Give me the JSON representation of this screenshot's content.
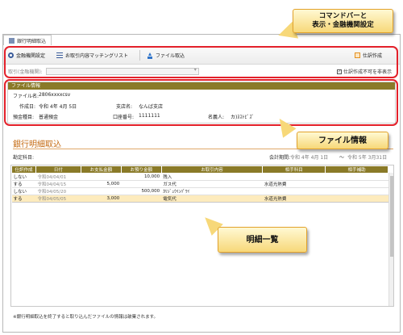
{
  "tab": {
    "label": "銀行明細取込"
  },
  "toolbar": {
    "bank_settings": "金融機関設定",
    "matching_list": "お取引内容マッチングリスト",
    "file_import": "ファイル取込",
    "journal": "仕訳作成"
  },
  "filter": {
    "label": "取引(金融機関):",
    "checkbox_label": "仕訳作成不可を非表示"
  },
  "file_info": {
    "header": "ファイル情報",
    "filename_label": "ファイル名:",
    "filename": "2806xxxxcsv",
    "created_label": "作成日:",
    "created": "令和 4年 4月 5日",
    "branch_label": "支店名:",
    "branch": "なんば支店",
    "account_type_label": "預金種目:",
    "account_type": "普通預金",
    "account_no_label": "口座番号:",
    "account_no": "1111111",
    "holder_label": "名義人:",
    "holder": "カ)ﾇｽﾄﾋﾞｽﾞ"
  },
  "page": {
    "title": "銀行明細取込",
    "subject_label": "勘定科目:",
    "period_label": "会計期間:",
    "period_from": "令和 4年 4月 1日",
    "period_sep": "〜",
    "period_to": "令和 5年 3月31日",
    "footnote": "※銀行明細取込を終了すると取り込んだファイルの情報は破棄されます。"
  },
  "table": {
    "headers": [
      "仕訳作成",
      "日付",
      "お支払金額",
      "お預り金額",
      "お取引内容",
      "相手科目",
      "相手補助"
    ],
    "rows": [
      {
        "c": [
          "しない",
          "令和04/04/01",
          "",
          "10,000",
          "残入",
          "",
          ""
        ]
      },
      {
        "c": [
          "する",
          "令和04/04/15",
          "5,000",
          "",
          "ガス代",
          "水道光熱費",
          ""
        ]
      },
      {
        "c": [
          "しない",
          "令和04/05/20",
          "",
          "500,000",
          "ｶﾘｼﾞｭｳｲﾝﾊﾟﾜｲ",
          "",
          ""
        ]
      },
      {
        "c": [
          "する",
          "令和04/05/05",
          "3,000",
          "",
          "電気代",
          "水道光熱費",
          ""
        ]
      }
    ]
  },
  "callouts": {
    "command_bar_line1": "コマンドバーと",
    "command_bar_line2": "表示・金融機関設定",
    "file_info": "ファイル情報",
    "detail_list": "明細一覧"
  },
  "colors": {
    "accent_brown": "#8a7a28",
    "title_orange": "#c46a12",
    "highlight_red": "#e3202a",
    "callout_yellow": "#f7d879"
  }
}
